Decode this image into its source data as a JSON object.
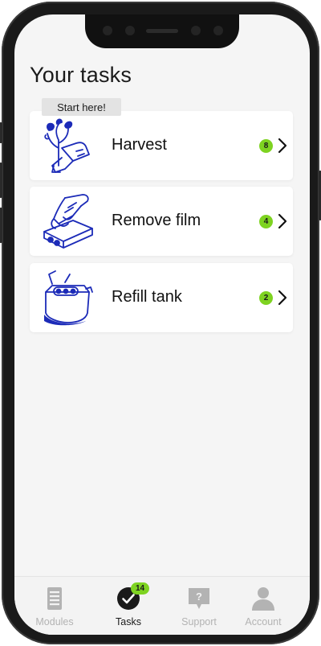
{
  "page": {
    "title": "Your tasks"
  },
  "start_hint": "Start here!",
  "tasks": [
    {
      "label": "Harvest",
      "count": "8",
      "illustration": "plant-harvest-icon"
    },
    {
      "label": "Remove film",
      "count": "4",
      "illustration": "hand-remove-film-icon"
    },
    {
      "label": "Refill tank",
      "count": "2",
      "illustration": "refill-tank-icon"
    }
  ],
  "tabbar": {
    "tabs": [
      {
        "label": "Modules",
        "icon": "modules-icon",
        "active": false
      },
      {
        "label": "Tasks",
        "icon": "tasks-check-icon",
        "active": true
      },
      {
        "label": "Support",
        "icon": "support-question-icon",
        "active": false
      },
      {
        "label": "Account",
        "icon": "account-person-icon",
        "active": false
      }
    ],
    "tasks_badge": "14"
  },
  "colors": {
    "accent_green": "#7ed321",
    "illustration_blue": "#1c2bb8",
    "active_tab": "#1a1a1a",
    "inactive_tab": "#b3b3b3"
  }
}
